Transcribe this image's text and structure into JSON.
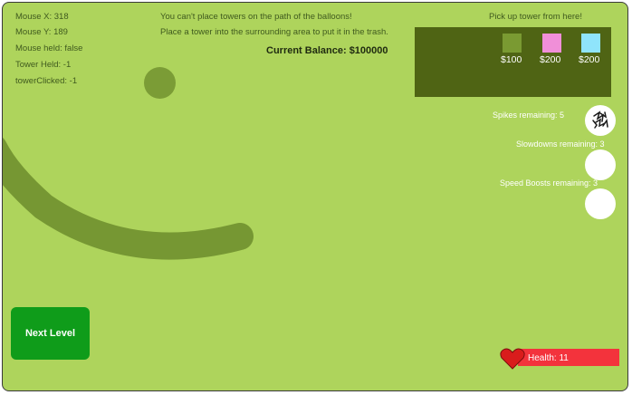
{
  "debug": {
    "mouse_x": "Mouse X: 318",
    "mouse_y": "Mouse Y: 189",
    "mouse_held": "Mouse held: false",
    "tower_held": "Tower Held: -1",
    "tower_clicked": "towerClicked: -1"
  },
  "hints": {
    "line1": "You can't place towers on the path of the balloons!",
    "line2": "Place a tower into the surrounding area to put it in the trash."
  },
  "balance": "Current Balance: $100000",
  "shop": {
    "title": "Pick up tower from here!",
    "towers": [
      {
        "price": "$100",
        "color": "#7a9a32"
      },
      {
        "price": "$200",
        "color": "#f08fd8"
      },
      {
        "price": "$200",
        "color": "#8fe4fb"
      }
    ]
  },
  "powerups": {
    "spikes": "Spikes remaining: 5",
    "slowdowns": "Slowdowns remaining: 3",
    "speed_boosts": "Speed Boosts remaining: 3"
  },
  "next_level": "Next Level",
  "health": "Health:   11",
  "colors": {
    "background": "#aed45c",
    "track": "#769733",
    "shop_panel": "#4f6414",
    "next_button": "#0f9c1a",
    "health_bar": "#f3333c",
    "heart": "#d91c1c"
  }
}
